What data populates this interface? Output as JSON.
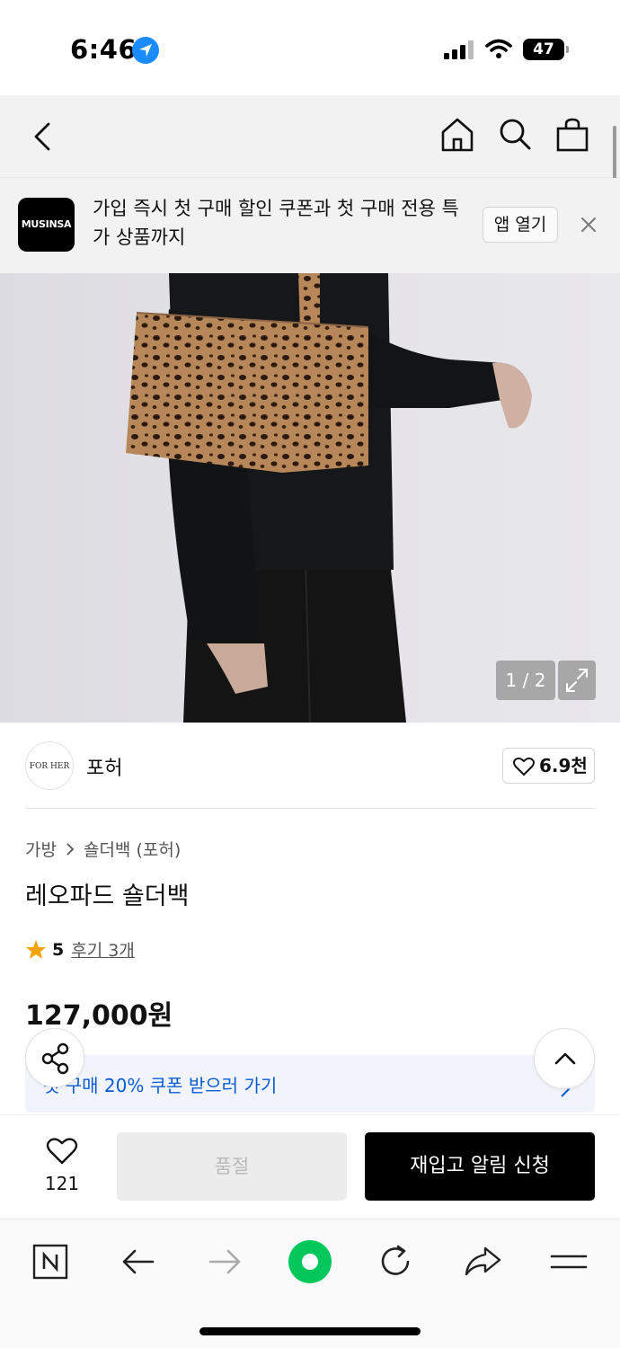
{
  "status_bar": {
    "time": "6:46",
    "battery": "47"
  },
  "nav": {
    "icons": [
      "back-icon",
      "home-icon",
      "search-icon",
      "bag-icon"
    ]
  },
  "banner": {
    "logo_text": "MUSINSA",
    "message": "가입 즉시 첫 구매 할인 쿠폰과 첫 구매 전용 특가 상품까지",
    "open_label": "앱 열기"
  },
  "gallery": {
    "counter": "1 / 2"
  },
  "brand": {
    "logo_text": "FOR HER",
    "name": "포허",
    "likes": "6.9천"
  },
  "product": {
    "breadcrumb": [
      "가방",
      "숄더백 (포허)"
    ],
    "title": "레오파드 숄더백",
    "rating": "5",
    "reviews": "후기 3개",
    "price": "127,000원"
  },
  "coupon": {
    "text": "첫 구매 20% 쿠폰 받으러 가기"
  },
  "purchase": {
    "wish_count": "121",
    "soldout_label": "품절",
    "restock_label": "재입고 알림 신청"
  },
  "colors": {
    "accent_blue": "#0a5bd3",
    "naver_green": "#03c75a",
    "star": "#f7a300"
  }
}
